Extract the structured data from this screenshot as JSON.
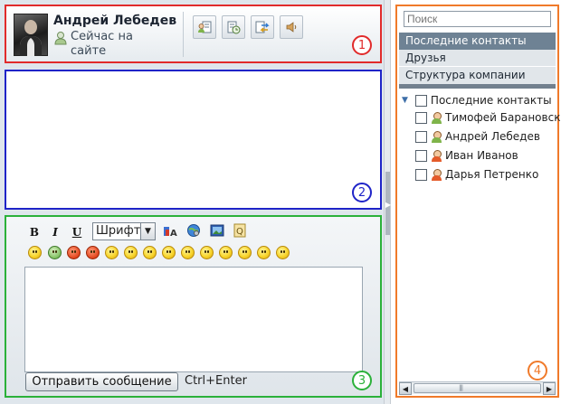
{
  "header": {
    "contact_name": "Андрей Лебедев",
    "status_text": "Сейчас на сайте",
    "toolbar": [
      {
        "icon": "contact-card-icon"
      },
      {
        "icon": "history-icon"
      },
      {
        "icon": "transfer-icon"
      },
      {
        "icon": "sound-icon"
      }
    ],
    "badge": "1"
  },
  "messages": {
    "badge": "2"
  },
  "compose": {
    "bold_label": "B",
    "italic_label": "I",
    "underline_label": "U",
    "font_select_value": "Шрифт",
    "send_button_label": "Отправить сообщение",
    "send_hotkey": "Ctrl+Enter",
    "badge": "3",
    "smileys_count_visible": 14
  },
  "sidebar": {
    "search_placeholder": "Поиск",
    "tabs": [
      {
        "label": "Последние контакты",
        "active": true
      },
      {
        "label": "Друзья",
        "active": false
      },
      {
        "label": "Структура компании",
        "active": false
      }
    ],
    "tree_root_label": "Последние контакты",
    "contacts": [
      {
        "name": "Тимофей Барановский",
        "gender": "male"
      },
      {
        "name": "Андрей Лебедев",
        "gender": "male"
      },
      {
        "name": "Иван Иванов",
        "gender": "female"
      },
      {
        "name": "Дарья Петренко",
        "gender": "female"
      }
    ],
    "badge": "4"
  },
  "colors": {
    "panel1_border": "#e12b2b",
    "panel2_border": "#1f24c8",
    "panel3_border": "#2bb13a",
    "panel4_border": "#f07a2a",
    "active_tab_bg": "#6e8294"
  }
}
